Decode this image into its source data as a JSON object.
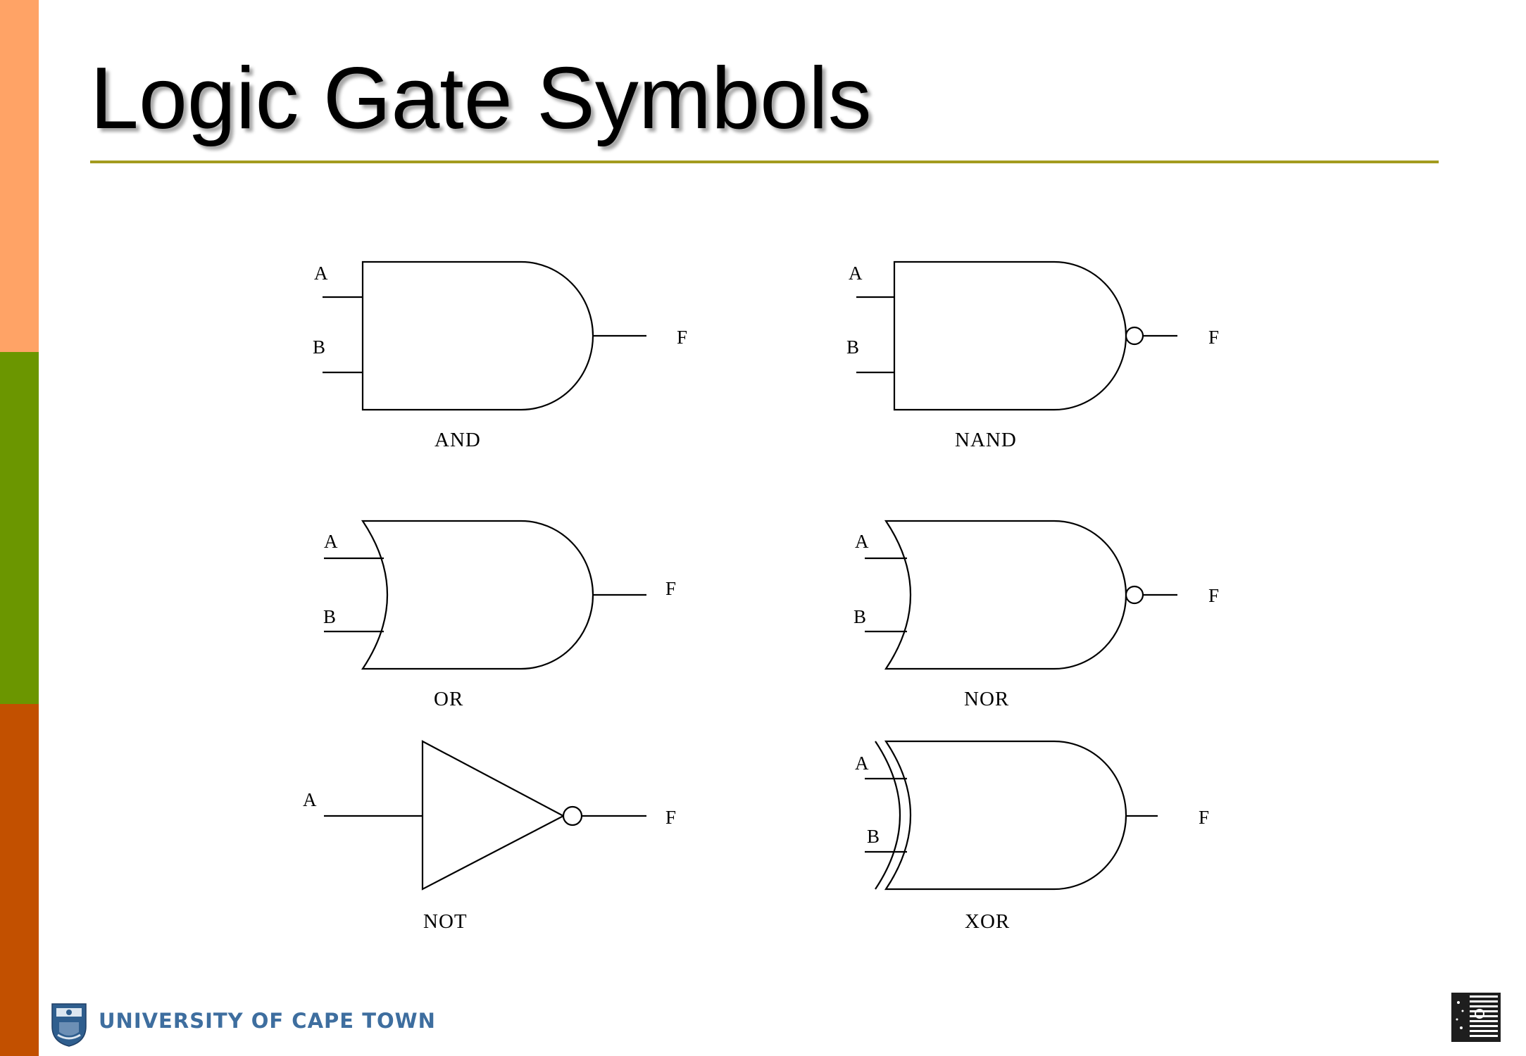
{
  "slide": {
    "title": "Logic Gate Symbols",
    "colors": {
      "band_top": "#FFA366",
      "band_middle": "#6B9600",
      "band_bottom": "#C25000",
      "title_rule": "#A39B1F",
      "footer_text": "#3E6E9F"
    }
  },
  "gates": {
    "and": {
      "name": "AND",
      "input_a": "A",
      "input_b": "B",
      "output": "F"
    },
    "nand": {
      "name": "NAND",
      "input_a": "A",
      "input_b": "B",
      "output": "F"
    },
    "or": {
      "name": "OR",
      "input_a": "A",
      "input_b": "B",
      "output": "F"
    },
    "nor": {
      "name": "NOR",
      "input_a": "A",
      "input_b": "B",
      "output": "F"
    },
    "not": {
      "name": "NOT",
      "input_a": "A",
      "output": "F"
    },
    "xor": {
      "name": "XOR",
      "input_a": "A",
      "input_b": "B",
      "output": "F"
    }
  },
  "footer": {
    "university_name": "UNIVERSITY OF CAPE TOWN",
    "logo_icon": "university-crest-icon",
    "corner_icon": "corner-emblem-icon"
  }
}
